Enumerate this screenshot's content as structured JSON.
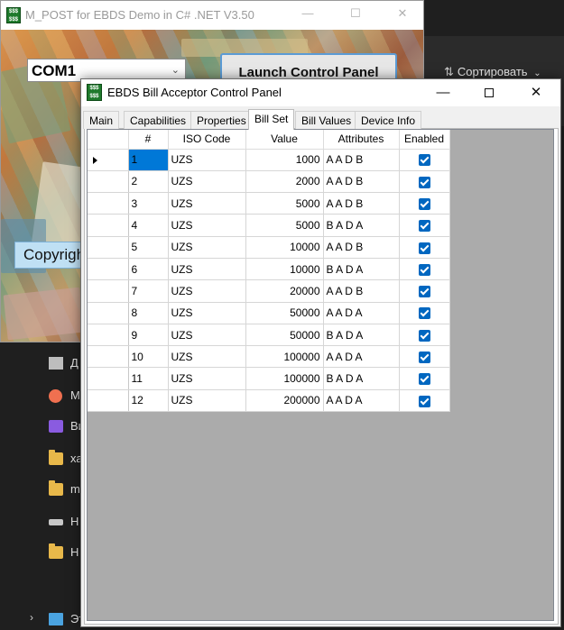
{
  "explorer": {
    "sort_label": "Сортировать",
    "items": [
      {
        "icon": "document-icon",
        "label": "Д"
      },
      {
        "icon": "music-icon",
        "label": "М"
      },
      {
        "icon": "video-icon",
        "label": "Ви"
      },
      {
        "icon": "folder-icon",
        "label": "ха"
      },
      {
        "icon": "folder-icon",
        "label": "m"
      },
      {
        "icon": "drive-icon",
        "label": "Н"
      },
      {
        "icon": "folder-icon",
        "label": "Н"
      },
      {
        "icon": "computer-icon",
        "label": "Эт"
      }
    ]
  },
  "main_window": {
    "title": "M_POST for EBDS Demo in C# .NET V3.50",
    "com_port": "COM1",
    "launch_label": "Launch Control Panel",
    "copyright_label": "Copyright"
  },
  "control_panel": {
    "title": "EBDS Bill Acceptor Control Panel",
    "tabs": [
      "Main",
      "Capabilities",
      "Properties",
      "Bill Set",
      "Bill Values",
      "Device Info"
    ],
    "active_tab": "Bill Set",
    "columns": [
      "#",
      "ISO Code",
      "Value",
      "Attributes",
      "Enabled"
    ],
    "rows": [
      {
        "num": "1",
        "iso": "UZS",
        "value": "1000",
        "attr": "A A D B",
        "enabled": true
      },
      {
        "num": "2",
        "iso": "UZS",
        "value": "2000",
        "attr": "A A D B",
        "enabled": true
      },
      {
        "num": "3",
        "iso": "UZS",
        "value": "5000",
        "attr": "A A D B",
        "enabled": true
      },
      {
        "num": "4",
        "iso": "UZS",
        "value": "5000",
        "attr": "B A D A",
        "enabled": true
      },
      {
        "num": "5",
        "iso": "UZS",
        "value": "10000",
        "attr": "A A D B",
        "enabled": true
      },
      {
        "num": "6",
        "iso": "UZS",
        "value": "10000",
        "attr": "B A D A",
        "enabled": true
      },
      {
        "num": "7",
        "iso": "UZS",
        "value": "20000",
        "attr": "A A D B",
        "enabled": true
      },
      {
        "num": "8",
        "iso": "UZS",
        "value": "50000",
        "attr": "A A D A",
        "enabled": true
      },
      {
        "num": "9",
        "iso": "UZS",
        "value": "50000",
        "attr": "B A D A",
        "enabled": true
      },
      {
        "num": "10",
        "iso": "UZS",
        "value": "100000",
        "attr": "A A D A",
        "enabled": true
      },
      {
        "num": "11",
        "iso": "UZS",
        "value": "100000",
        "attr": "B A D A",
        "enabled": true
      },
      {
        "num": "12",
        "iso": "UZS",
        "value": "200000",
        "attr": "A A D A",
        "enabled": true
      }
    ],
    "selected_row": 0,
    "accent_color": "#0078d7"
  }
}
